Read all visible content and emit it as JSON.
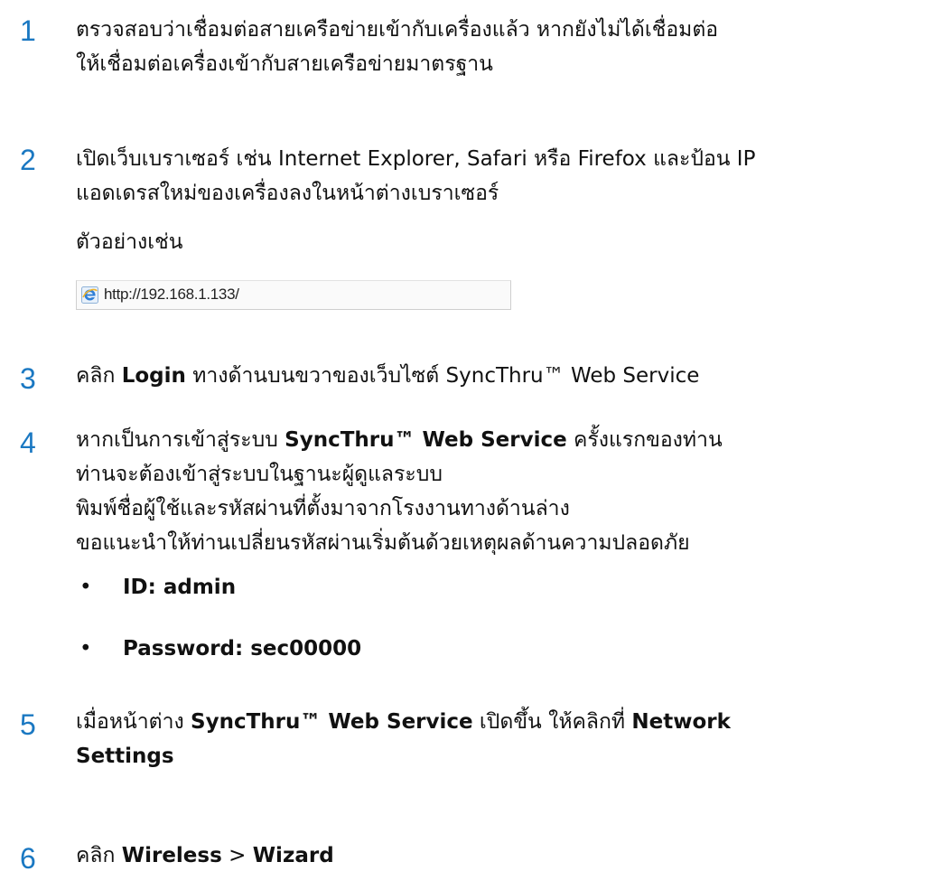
{
  "steps": [
    {
      "number": "1",
      "line1": "ตรวจสอบว่าเชื่อมต่อสายเครือข่ายเข้ากับเครื่องแล้ว หากยังไม่ได้เชื่อมต่อ",
      "line2": "ให้เชื่อมต่อเครื่องเข้ากับสายเครือข่ายมาตรฐาน"
    },
    {
      "number": "2",
      "line1": "เปิดเว็บเบราเซอร์ เช่น Internet Explorer, Safari หรือ Firefox และป้อน IP",
      "line2": "แอดเดรสใหม่ของเครื่องลงในหน้าต่างเบราเซอร์",
      "example_label": "ตัวอย่างเช่น",
      "example_url": "http://192.168.1.133/"
    },
    {
      "number": "3",
      "pre": "คลิก ",
      "bold": "Login",
      "post": " ทางด้านบนขวาของเว็บไซต์ SyncThru™ Web Service"
    },
    {
      "number": "4",
      "line1_pre": "หากเป็นการเข้าสู่ระบบ ",
      "line1_bold": "SyncThru™ Web Service",
      "line1_post": " ครั้งแรกของท่าน",
      "line2": "ท่านจะต้องเข้าสู่ระบบในฐานะผู้ดูแลระบบ",
      "line3": "พิมพ์ชื่อผู้ใช้และรหัสผ่านที่ตั้งมาจากโรงงานทางด้านล่าง",
      "line4": "ขอแนะนำให้ท่านเปลี่ยนรหัสผ่านเริ่มต้นด้วยเหตุผลด้านความปลอดภัย",
      "bullet_char": "•",
      "bullets": [
        "ID: admin",
        "Password: sec00000"
      ]
    },
    {
      "number": "5",
      "line1_pre": "เมื่อหน้าต่าง ",
      "line1_bold1": "SyncThru™ Web Service",
      "line1_mid": " เปิดขึ้น ให้คลิกที่ ",
      "line1_bold2": "Network",
      "line2_bold": "Settings"
    },
    {
      "number": "6",
      "pre": "คลิก ",
      "bold1": "Wireless",
      "mid": " > ",
      "bold2": "Wizard"
    }
  ],
  "colors": {
    "step_number": "#1a78c2",
    "text": "#111111"
  },
  "icons": {
    "browser_icon": "internet-explorer-icon"
  }
}
